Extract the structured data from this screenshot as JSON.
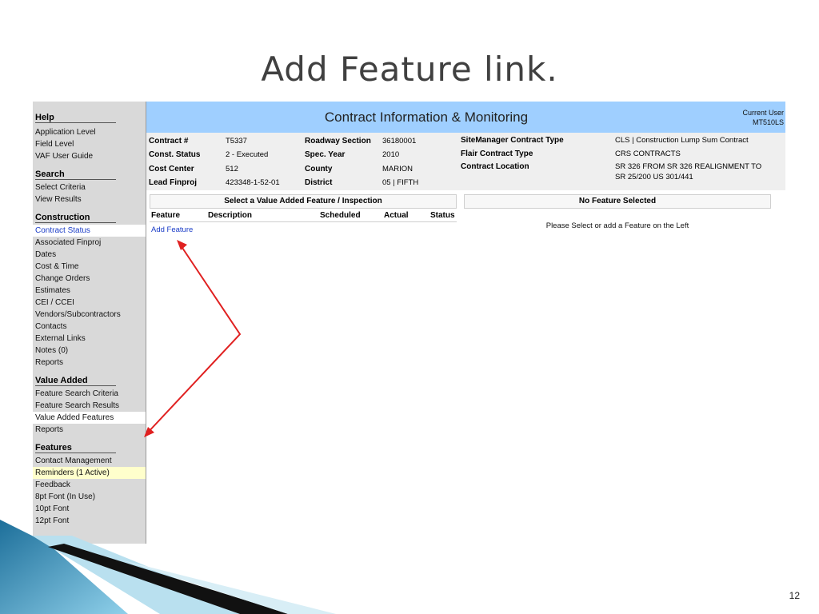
{
  "slide": {
    "title": "Add Feature link.",
    "page_number": "12"
  },
  "colors": {
    "header_bar": "#9fcfff",
    "sidebar_bg": "#d9d9d9",
    "link_blue": "#1a3cc7",
    "arrow_red": "#e02020",
    "reminder_highlight": "#ffffcc"
  },
  "sidebar": {
    "sections": [
      {
        "heading": "Help",
        "items": [
          "Application Level",
          "Field Level",
          "VAF User Guide"
        ]
      },
      {
        "heading": "Search",
        "items": [
          "Select Criteria",
          "View Results"
        ]
      },
      {
        "heading": "Construction",
        "items": [
          "Contract Status",
          "Associated Finproj",
          "Dates",
          "Cost & Time",
          "Change Orders",
          "Estimates",
          "CEI / CCEI",
          "Vendors/Subcontractors",
          "Contacts",
          "External Links",
          "Notes (0)",
          "Reports"
        ]
      },
      {
        "heading": "Value Added",
        "items": [
          "Feature Search Criteria",
          "Feature Search Results",
          "Value Added Features",
          "Reports"
        ]
      },
      {
        "heading": "Features",
        "items": [
          "Contact Management",
          "Reminders (1 Active)",
          "Feedback",
          "8pt Font (In Use)",
          "10pt Font",
          "12pt Font"
        ]
      }
    ]
  },
  "header": {
    "title": "Contract Information & Monitoring",
    "current_user_label": "Current User",
    "current_user": "MT510LS"
  },
  "contract_info": {
    "contract_no_label": "Contract #",
    "contract_no": "T5337",
    "const_status_label": "Const. Status",
    "const_status": "2 - Executed",
    "cost_center_label": "Cost Center",
    "cost_center": "512",
    "lead_finproj_label": "Lead Finproj",
    "lead_finproj": "423348-1-52-01",
    "roadway_section_label": "Roadway Section",
    "roadway_section": "36180001",
    "spec_year_label": "Spec. Year",
    "spec_year": "2010",
    "county_label": "County",
    "county": "MARION",
    "district_label": "District",
    "district": "05 | FIFTH",
    "sitemanager_type_label": "SiteManager Contract Type",
    "sitemanager_type": "CLS | Construction Lump Sum Contract",
    "flair_type_label": "Flair Contract Type",
    "flair_type": "CRS CONTRACTS",
    "location_label": "Contract Location",
    "location_line1": "SR 326 FROM SR 326 REALIGNMENT TO",
    "location_line2": "SR 25/200 US 301/441"
  },
  "feature_panel": {
    "title": "Select a Value Added Feature / Inspection",
    "columns": [
      "Feature",
      "Description",
      "Scheduled",
      "Actual",
      "Status"
    ],
    "add_feature_link": "Add Feature"
  },
  "detail_panel": {
    "title": "No Feature Selected",
    "message": "Please Select or add a Feature on the Left"
  }
}
